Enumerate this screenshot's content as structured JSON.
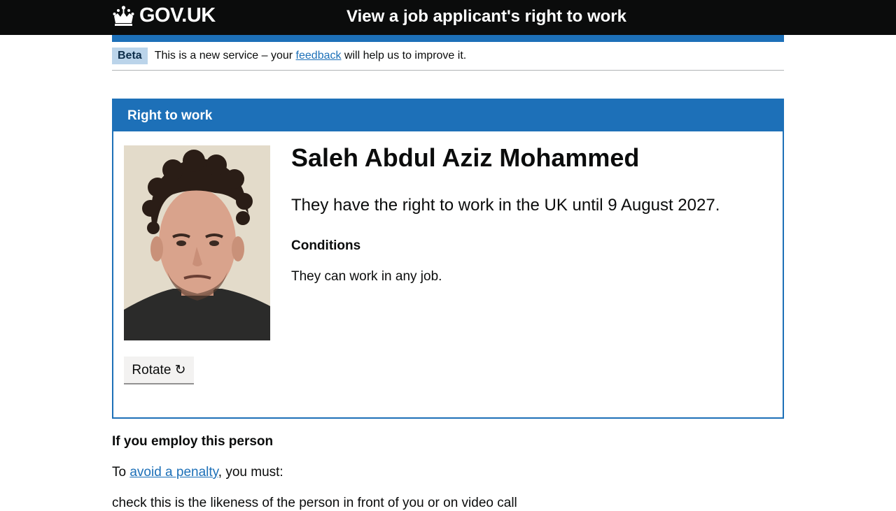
{
  "header": {
    "logo_text": "GOV.UK",
    "service_name": "View a job applicant's right to work"
  },
  "phase": {
    "tag": "Beta",
    "text_before": "This is a new service – your ",
    "link": "feedback",
    "text_after": " will help us to improve it."
  },
  "panel": {
    "heading": "Right to work",
    "name": "Saleh Abdul Aziz Mohammed",
    "status": "They have the right to work in the UK until 9 August 2027.",
    "conditions_heading": "Conditions",
    "conditions_text": "They can work in any job.",
    "rotate_label": "Rotate ↻"
  },
  "employ": {
    "heading": "If you employ this person",
    "intro_before": "To ",
    "intro_link": "avoid a penalty",
    "intro_after": ", you must:",
    "item_partial": "check this is the likeness of the person in front of you or on video call"
  },
  "colors": {
    "brand_blue": "#1d70b8",
    "header_black": "#0b0c0c",
    "tag_bg": "#bbd4ea"
  },
  "icons": {
    "logo": "crown-icon"
  }
}
